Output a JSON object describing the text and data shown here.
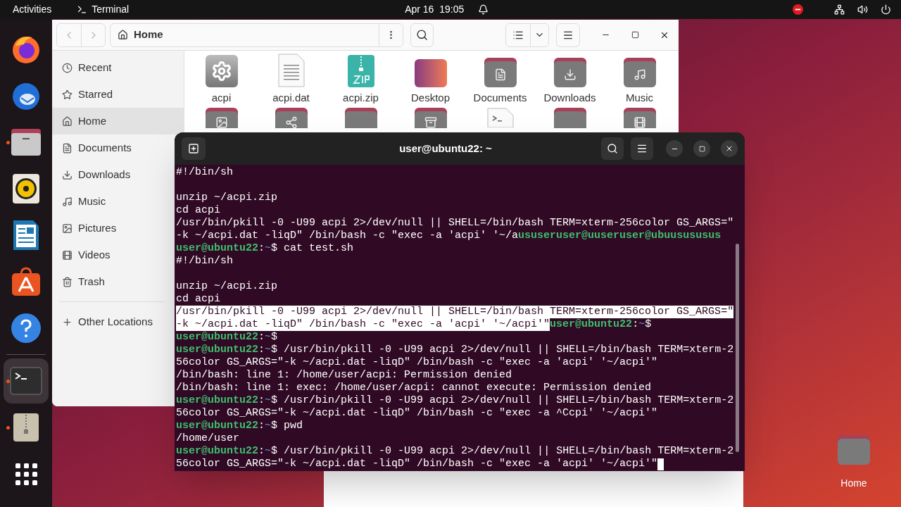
{
  "top_bar": {
    "activities": "Activities",
    "app_name": "Terminal",
    "clock": "Apr 16  19:05"
  },
  "dock": [
    {
      "kind": "firefox",
      "running": false,
      "active": false
    },
    {
      "kind": "thunderbird",
      "running": false,
      "active": false
    },
    {
      "kind": "files",
      "running": true,
      "active": false
    },
    {
      "kind": "rhythmbox",
      "running": false,
      "active": false
    },
    {
      "kind": "writer",
      "running": false,
      "active": false
    },
    {
      "kind": "software",
      "running": false,
      "active": false
    },
    {
      "kind": "help",
      "running": false,
      "active": false
    },
    {
      "kind": "terminal",
      "running": true,
      "active": true
    },
    {
      "kind": "archive",
      "running": true,
      "active": false
    },
    {
      "kind": "apps",
      "running": false,
      "active": false
    }
  ],
  "files_window": {
    "location": "Home",
    "sidebar": [
      {
        "label": "Recent",
        "kind": "recent",
        "selected": false
      },
      {
        "label": "Starred",
        "kind": "starred",
        "selected": false
      },
      {
        "label": "Home",
        "kind": "home",
        "selected": true
      },
      {
        "label": "Documents",
        "kind": "documents",
        "selected": false
      },
      {
        "label": "Downloads",
        "kind": "downloads",
        "selected": false
      },
      {
        "label": "Music",
        "kind": "music",
        "selected": false
      },
      {
        "label": "Pictures",
        "kind": "pictures",
        "selected": false
      },
      {
        "label": "Videos",
        "kind": "videos",
        "selected": false
      },
      {
        "label": "Trash",
        "kind": "trash",
        "selected": false
      },
      {
        "label": "Other Locations",
        "kind": "other",
        "selected": false
      }
    ],
    "icons": [
      {
        "label": "acpi",
        "kind": "executable"
      },
      {
        "label": "acpi.dat",
        "kind": "text"
      },
      {
        "label": "acpi.zip",
        "kind": "zip"
      },
      {
        "label": "Desktop",
        "kind": "desktop"
      },
      {
        "label": "Documents",
        "kind": "documents"
      },
      {
        "label": "Downloads",
        "kind": "downloads"
      },
      {
        "label": "Music",
        "kind": "music"
      }
    ],
    "icons_row2": [
      {
        "kind": "pictures"
      },
      {
        "kind": "public"
      },
      {
        "kind": "folder"
      },
      {
        "kind": "archive"
      },
      {
        "kind": "script"
      },
      {
        "kind": "folder"
      },
      {
        "kind": "videos"
      }
    ]
  },
  "terminal": {
    "title": "user@ubuntu22: ~",
    "cursor": true,
    "lines": [
      {
        "kind": "text",
        "segments": [
          {
            "text": "#!/bin/sh",
            "kind": "plain"
          }
        ]
      },
      {
        "kind": "blank"
      },
      {
        "kind": "text",
        "segments": [
          {
            "text": "unzip ~/acpi.zip",
            "kind": "plain"
          }
        ]
      },
      {
        "kind": "text",
        "segments": [
          {
            "text": "cd acpi",
            "kind": "plain"
          }
        ]
      },
      {
        "kind": "text",
        "segments": [
          {
            "text": "/usr/bin/pkill -0 -U99 acpi 2>/dev/null || SHELL=/bin/bash TERM=xterm-256color GS_ARGS=\"",
            "kind": "plain"
          }
        ]
      },
      {
        "kind": "text",
        "segments": [
          {
            "text": "-k ~/acpi.dat -liqD\" /bin/bash -c \"exec -a 'acpi' '~/a",
            "kind": "plain"
          },
          {
            "text": "ususeruser@uuseruser@ubuusususus",
            "kind": "user"
          }
        ]
      },
      {
        "kind": "text",
        "segments": [
          {
            "text": "user@ubuntu22",
            "kind": "user"
          },
          {
            "text": ":",
            "kind": "plain"
          },
          {
            "text": "~",
            "kind": "cwd"
          },
          {
            "text": "$ cat test.sh",
            "kind": "plain"
          }
        ]
      },
      {
        "kind": "text",
        "segments": [
          {
            "text": "#!/bin/sh",
            "kind": "plain"
          }
        ]
      },
      {
        "kind": "blank"
      },
      {
        "kind": "text",
        "segments": [
          {
            "text": "unzip ~/acpi.zip",
            "kind": "plain"
          }
        ]
      },
      {
        "kind": "text",
        "segments": [
          {
            "text": "cd acpi",
            "kind": "plain"
          }
        ]
      },
      {
        "kind": "text",
        "segments": [
          {
            "text": "/usr/bin/pkill -0 -U99 acpi 2>/dev/null || SHELL=/bin/bash TERM=xterm-256color GS_ARGS=\"",
            "kind": "sel"
          }
        ]
      },
      {
        "kind": "text",
        "segments": [
          {
            "text": "-k ~/acpi.dat -liqD\" /bin/bash -c \"exec -a 'acpi' '~/acpi'\"",
            "kind": "sel"
          },
          {
            "text": "user@ubuntu22",
            "kind": "user"
          },
          {
            "text": ":",
            "kind": "plain"
          },
          {
            "text": "~",
            "kind": "cwd"
          },
          {
            "text": "$",
            "kind": "plain"
          }
        ]
      },
      {
        "kind": "text",
        "segments": [
          {
            "text": "user@ubuntu22",
            "kind": "user"
          },
          {
            "text": ":",
            "kind": "plain"
          },
          {
            "text": "~",
            "kind": "cwd"
          },
          {
            "text": "$",
            "kind": "plain"
          }
        ]
      },
      {
        "kind": "text",
        "segments": [
          {
            "text": "user@ubuntu22",
            "kind": "user"
          },
          {
            "text": ":",
            "kind": "plain"
          },
          {
            "text": "~",
            "kind": "cwd"
          },
          {
            "text": "$ /usr/bin/pkill -0 -U99 acpi 2>/dev/null || SHELL=/bin/bash TERM=xterm-2",
            "kind": "plain"
          }
        ]
      },
      {
        "kind": "text",
        "segments": [
          {
            "text": "56color GS_ARGS=\"-k ~/acpi.dat -liqD\" /bin/bash -c \"exec -a 'acpi' '~/acpi'\"",
            "kind": "plain"
          }
        ]
      },
      {
        "kind": "text",
        "segments": [
          {
            "text": "/bin/bash: line 1: /home/user/acpi: Permission denied",
            "kind": "plain"
          }
        ]
      },
      {
        "kind": "text",
        "segments": [
          {
            "text": "/bin/bash: line 1: exec: /home/user/acpi: cannot execute: Permission denied",
            "kind": "plain"
          }
        ]
      },
      {
        "kind": "text",
        "segments": [
          {
            "text": "user@ubuntu22",
            "kind": "user"
          },
          {
            "text": ":",
            "kind": "plain"
          },
          {
            "text": "~",
            "kind": "cwd"
          },
          {
            "text": "$ /usr/bin/pkill -0 -U99 acpi 2>/dev/null || SHELL=/bin/bash TERM=xterm-2",
            "kind": "plain"
          }
        ]
      },
      {
        "kind": "text",
        "segments": [
          {
            "text": "56color GS_ARGS=\"-k ~/acpi.dat -liqD\" /bin/bash -c \"exec -a ^Ccpi' '~/acpi'\"",
            "kind": "plain"
          }
        ]
      },
      {
        "kind": "text",
        "segments": [
          {
            "text": "user@ubuntu22",
            "kind": "user"
          },
          {
            "text": ":",
            "kind": "plain"
          },
          {
            "text": "~",
            "kind": "cwd"
          },
          {
            "text": "$ pwd",
            "kind": "plain"
          }
        ]
      },
      {
        "kind": "text",
        "segments": [
          {
            "text": "/home/user",
            "kind": "plain"
          }
        ]
      },
      {
        "kind": "text",
        "segments": [
          {
            "text": "user@ubuntu22",
            "kind": "user"
          },
          {
            "text": ":",
            "kind": "plain"
          },
          {
            "text": "~",
            "kind": "cwd"
          },
          {
            "text": "$ /usr/bin/pkill -0 -U99 acpi 2>/dev/null || SHELL=/bin/bash TERM=xterm-2",
            "kind": "plain"
          }
        ]
      },
      {
        "kind": "text",
        "segments": [
          {
            "text": "56color GS_ARGS=\"-k ~/acpi.dat -liqD\" /bin/bash -c \"exec -a 'acpi' '~/acpi'\"",
            "kind": "plain"
          }
        ]
      }
    ]
  },
  "desktop": {
    "home_label": "Home"
  }
}
